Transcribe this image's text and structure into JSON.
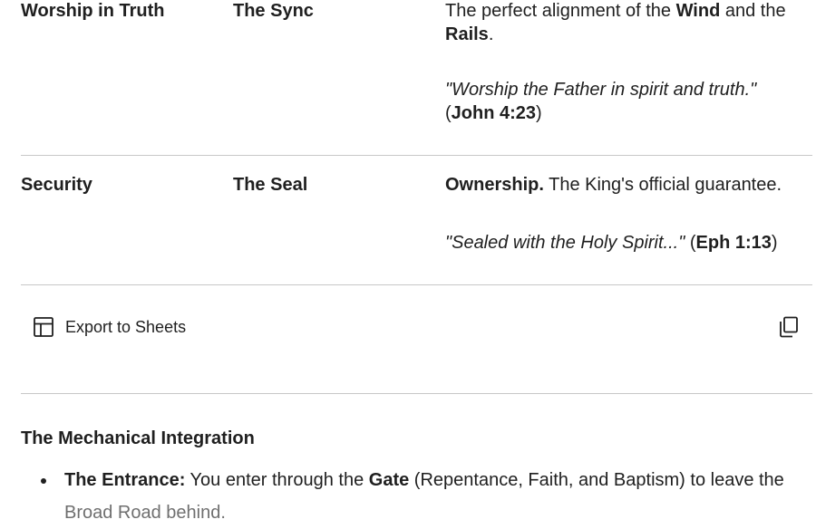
{
  "table": {
    "rows": [
      {
        "col1": "Worship in Truth",
        "col2": "The Sync",
        "p1": {
          "before": "The perfect alignment of the ",
          "bold1": "Wind",
          "mid": " and the ",
          "bold2": "Rails",
          "after": "."
        },
        "p2": {
          "quote": "\"Worship the Father in spirit and truth.\"",
          "open": " (",
          "ref": "John 4:23",
          "close": ")"
        }
      },
      {
        "col1": "Security",
        "col2": "The Seal",
        "p1": {
          "bold": "Ownership.",
          "after": " The King's official guarantee."
        },
        "p2": {
          "quote": "\"Sealed with the Holy Spirit...\"",
          "open": " (",
          "ref": "Eph 1:13",
          "close": ")"
        }
      }
    ]
  },
  "toolbar": {
    "export_label": "Export to Sheets",
    "export_icon": "table-icon",
    "copy_icon": "copy-icon"
  },
  "section": {
    "heading": "The Mechanical Integration",
    "bullets": [
      {
        "bold": "The Entrance:",
        "t1": " You enter through the ",
        "bold2": "Gate",
        "t2": " (Repentance, Faith, and Baptism) to leave the",
        "t3": "Broad Road behind."
      }
    ]
  },
  "colors": {
    "text": "#1f1f1f",
    "divider": "#c7c7c7",
    "faded_text": "#6f6f6f"
  }
}
